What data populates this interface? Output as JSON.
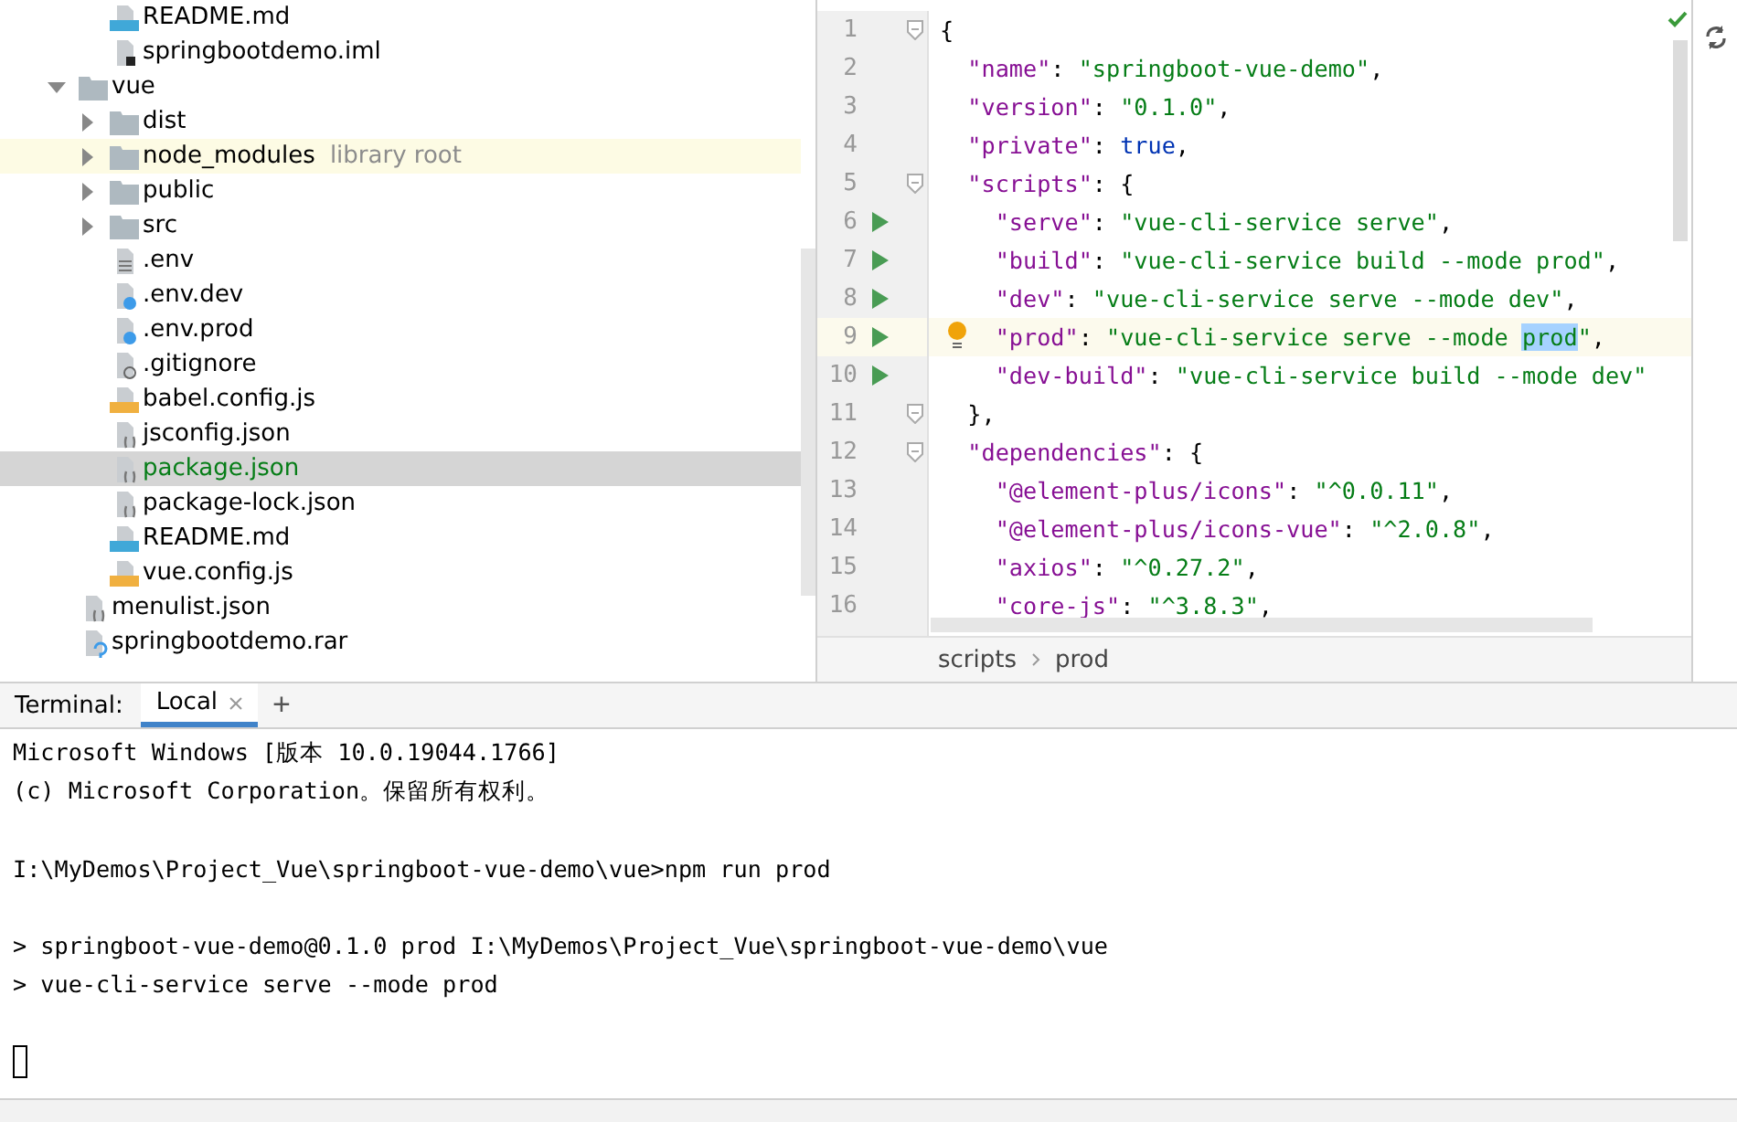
{
  "project_tree": {
    "items": [
      {
        "children": [
          {
            "name": "README.md",
            "kind": "md",
            "selected": false
          },
          {
            "name": "springbootdemo.iml",
            "kind": "iml",
            "selected": false
          }
        ]
      },
      {
        "name": "vue",
        "kind": "folder",
        "expanded": true,
        "selected": false,
        "children": [
          {
            "name": "dist",
            "kind": "folder",
            "expanded": false,
            "selected": false
          },
          {
            "name": "node_modules",
            "kind": "folder",
            "expanded": false,
            "selected": false,
            "note": "library root"
          },
          {
            "name": "public",
            "kind": "folder",
            "expanded": false,
            "selected": false
          },
          {
            "name": "src",
            "kind": "folder",
            "expanded": false,
            "selected": false
          },
          {
            "name": ".env",
            "kind": "text",
            "selected": false
          },
          {
            "name": ".env.dev",
            "kind": "config",
            "selected": false
          },
          {
            "name": ".env.prod",
            "kind": "config",
            "selected": false
          },
          {
            "name": ".gitignore",
            "kind": "ignore",
            "selected": false
          },
          {
            "name": "babel.config.js",
            "kind": "js",
            "selected": false
          },
          {
            "name": "jsconfig.json",
            "kind": "json",
            "selected": false
          },
          {
            "name": "package.json",
            "kind": "json",
            "selected": true
          },
          {
            "name": "package-lock.json",
            "kind": "json",
            "selected": false
          },
          {
            "name": "README.md",
            "kind": "md",
            "selected": false
          },
          {
            "name": "vue.config.js",
            "kind": "js",
            "selected": false
          }
        ]
      },
      {
        "name": "menulist.json",
        "kind": "json",
        "selected": false
      },
      {
        "name": "springbootdemo.rar",
        "kind": "archive",
        "selected": false
      }
    ]
  },
  "editor": {
    "lines": [
      {
        "number": "1",
        "fold": true,
        "run": false,
        "bulb": false,
        "current": false,
        "tokens": [
          {
            "kind": "punct",
            "text": "{"
          }
        ]
      },
      {
        "number": "2",
        "fold": false,
        "run": false,
        "bulb": false,
        "current": false,
        "tokens": [
          {
            "kind": "key",
            "text": "  \"name\""
          },
          {
            "kind": "punct",
            "text": ": "
          },
          {
            "kind": "str",
            "text": "\"springboot-vue-demo\""
          },
          {
            "kind": "punct",
            "text": ","
          }
        ]
      },
      {
        "number": "3",
        "fold": false,
        "run": false,
        "bulb": false,
        "current": false,
        "tokens": [
          {
            "kind": "key",
            "text": "  \"version\""
          },
          {
            "kind": "punct",
            "text": ": "
          },
          {
            "kind": "str",
            "text": "\"0.1.0\""
          },
          {
            "kind": "punct",
            "text": ","
          }
        ]
      },
      {
        "number": "4",
        "fold": false,
        "run": false,
        "bulb": false,
        "current": false,
        "tokens": [
          {
            "kind": "key",
            "text": "  \"private\""
          },
          {
            "kind": "punct",
            "text": ": "
          },
          {
            "kind": "kw",
            "text": "true"
          },
          {
            "kind": "punct",
            "text": ","
          }
        ]
      },
      {
        "number": "5",
        "fold": true,
        "run": false,
        "bulb": false,
        "current": false,
        "tokens": [
          {
            "kind": "key",
            "text": "  \"scripts\""
          },
          {
            "kind": "punct",
            "text": ": {"
          }
        ]
      },
      {
        "number": "6",
        "fold": false,
        "run": true,
        "bulb": false,
        "current": false,
        "tokens": [
          {
            "kind": "key",
            "text": "    \"serve\""
          },
          {
            "kind": "punct",
            "text": ": "
          },
          {
            "kind": "str",
            "text": "\"vue-cli-service serve\""
          },
          {
            "kind": "punct",
            "text": ","
          }
        ]
      },
      {
        "number": "7",
        "fold": false,
        "run": true,
        "bulb": false,
        "current": false,
        "tokens": [
          {
            "kind": "key",
            "text": "    \"build\""
          },
          {
            "kind": "punct",
            "text": ": "
          },
          {
            "kind": "str",
            "text": "\"vue-cli-service build --mode prod\""
          },
          {
            "kind": "punct",
            "text": ","
          }
        ]
      },
      {
        "number": "8",
        "fold": false,
        "run": true,
        "bulb": false,
        "current": false,
        "tokens": [
          {
            "kind": "key",
            "text": "    \"dev\""
          },
          {
            "kind": "punct",
            "text": ": "
          },
          {
            "kind": "str",
            "text": "\"vue-cli-service serve --mode dev\""
          },
          {
            "kind": "punct",
            "text": ","
          }
        ]
      },
      {
        "number": "9",
        "fold": false,
        "run": true,
        "bulb": true,
        "current": true,
        "tokens": [
          {
            "kind": "key",
            "text": "    \"prod\""
          },
          {
            "kind": "punct",
            "text": ": "
          },
          {
            "kind": "str",
            "text": "\"vue-cli-service serve --mode "
          },
          {
            "kind": "sel",
            "text": "prod"
          },
          {
            "kind": "str",
            "text": "\""
          },
          {
            "kind": "punct",
            "text": ","
          }
        ]
      },
      {
        "number": "10",
        "fold": false,
        "run": true,
        "bulb": false,
        "current": false,
        "tokens": [
          {
            "kind": "key",
            "text": "    \"dev-build\""
          },
          {
            "kind": "punct",
            "text": ": "
          },
          {
            "kind": "str",
            "text": "\"vue-cli-service build --mode dev\""
          }
        ]
      },
      {
        "number": "11",
        "fold": true,
        "run": false,
        "bulb": false,
        "current": false,
        "tokens": [
          {
            "kind": "punct",
            "text": "  },"
          }
        ]
      },
      {
        "number": "12",
        "fold": true,
        "run": false,
        "bulb": false,
        "current": false,
        "tokens": [
          {
            "kind": "key",
            "text": "  \"dependencies\""
          },
          {
            "kind": "punct",
            "text": ": {"
          }
        ]
      },
      {
        "number": "13",
        "fold": false,
        "run": false,
        "bulb": false,
        "current": false,
        "tokens": [
          {
            "kind": "key",
            "text": "    \"@element-plus/icons\""
          },
          {
            "kind": "punct",
            "text": ": "
          },
          {
            "kind": "str",
            "text": "\"^0.0.11\""
          },
          {
            "kind": "punct",
            "text": ","
          }
        ]
      },
      {
        "number": "14",
        "fold": false,
        "run": false,
        "bulb": false,
        "current": false,
        "tokens": [
          {
            "kind": "key",
            "text": "    \"@element-plus/icons-vue\""
          },
          {
            "kind": "punct",
            "text": ": "
          },
          {
            "kind": "str",
            "text": "\"^2.0.8\""
          },
          {
            "kind": "punct",
            "text": ","
          }
        ]
      },
      {
        "number": "15",
        "fold": false,
        "run": false,
        "bulb": false,
        "current": false,
        "tokens": [
          {
            "kind": "key",
            "text": "    \"axios\""
          },
          {
            "kind": "punct",
            "text": ": "
          },
          {
            "kind": "str",
            "text": "\"^0.27.2\""
          },
          {
            "kind": "punct",
            "text": ","
          }
        ]
      },
      {
        "number": "16",
        "fold": false,
        "run": false,
        "bulb": false,
        "current": false,
        "tokens": [
          {
            "kind": "key",
            "text": "    \"core-js\""
          },
          {
            "kind": "punct",
            "text": ": "
          },
          {
            "kind": "str",
            "text": "\"^3.8.3\""
          },
          {
            "kind": "punct",
            "text": ","
          }
        ]
      }
    ],
    "breadcrumb": [
      "scripts",
      "prod"
    ]
  },
  "terminal": {
    "label": "Terminal:",
    "tabs": [
      {
        "label": "Local",
        "selected": true
      }
    ],
    "new_tab": "+",
    "blocks": [
      [
        "Microsoft Windows [版本 10.0.19044.1766]",
        "(c) Microsoft Corporation。保留所有权利。"
      ],
      [
        "I:\\MyDemos\\Project_Vue\\springboot-vue-demo\\vue>npm run prod"
      ],
      [
        "> springboot-vue-demo@0.1.0 prod I:\\MyDemos\\Project_Vue\\springboot-vue-demo\\vue",
        "> vue-cli-service serve --mode prod"
      ]
    ]
  }
}
